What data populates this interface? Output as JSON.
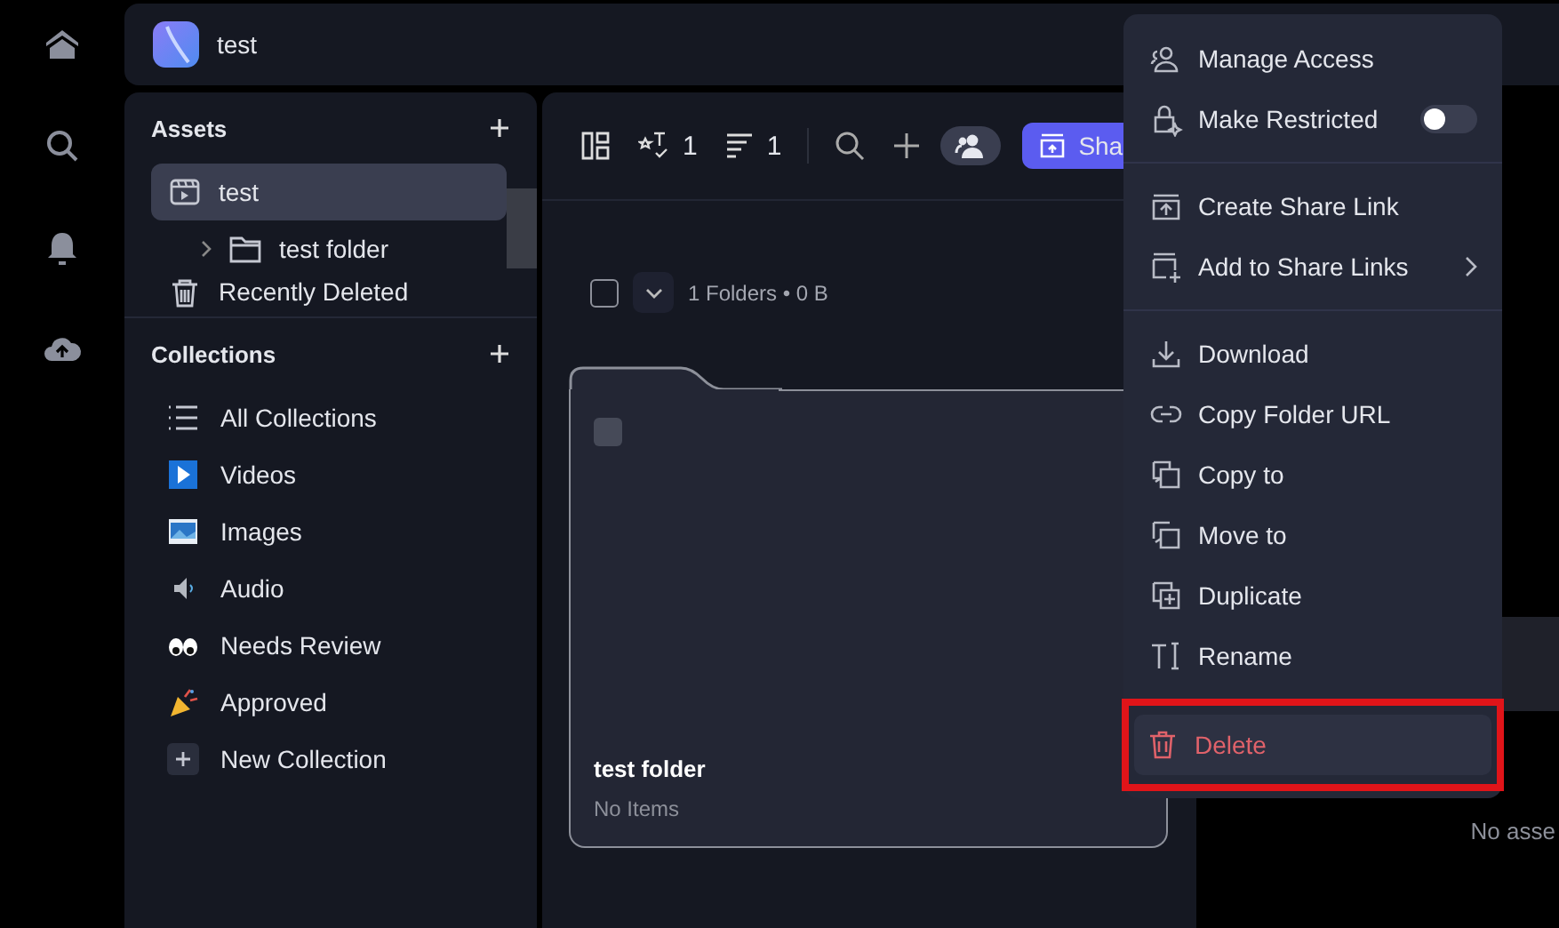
{
  "workspace": {
    "title": "test"
  },
  "assets": {
    "title": "Assets",
    "items": [
      {
        "label": "test",
        "selected": true,
        "children": [
          {
            "label": "test folder",
            "selected": false
          }
        ]
      },
      {
        "label": "Recently Deleted",
        "selected": false
      }
    ]
  },
  "collections": {
    "title": "Collections",
    "items": [
      {
        "label": "All Collections"
      },
      {
        "label": "Videos"
      },
      {
        "label": "Images"
      },
      {
        "label": "Audio"
      },
      {
        "label": "Needs Review"
      },
      {
        "label": "Approved"
      },
      {
        "label": "New Collection"
      }
    ]
  },
  "toolbar": {
    "filter_count": "1",
    "sort_count": "1",
    "share_label": "Sha"
  },
  "select_all": {
    "checked": false
  },
  "summary": "1 Folders • 0 B",
  "folder": {
    "name": "test folder",
    "detail": "No Items",
    "checked": false
  },
  "preview": {
    "empty_text": "No asse"
  },
  "menu": {
    "groups": [
      [
        {
          "label": "Manage Access",
          "kind": "item"
        },
        {
          "label": "Make Restricted",
          "kind": "toggle",
          "on": false
        }
      ],
      [
        {
          "label": "Create Share Link",
          "kind": "item"
        },
        {
          "label": "Add to Share Links",
          "kind": "submenu"
        }
      ],
      [
        {
          "label": "Download",
          "kind": "item"
        },
        {
          "label": "Copy Folder URL",
          "kind": "item"
        },
        {
          "label": "Copy to",
          "kind": "item"
        },
        {
          "label": "Move to",
          "kind": "item"
        },
        {
          "label": "Duplicate",
          "kind": "item"
        },
        {
          "label": "Rename",
          "kind": "item"
        }
      ],
      [
        {
          "label": "Delete",
          "kind": "danger",
          "highlighted": true
        }
      ]
    ]
  }
}
